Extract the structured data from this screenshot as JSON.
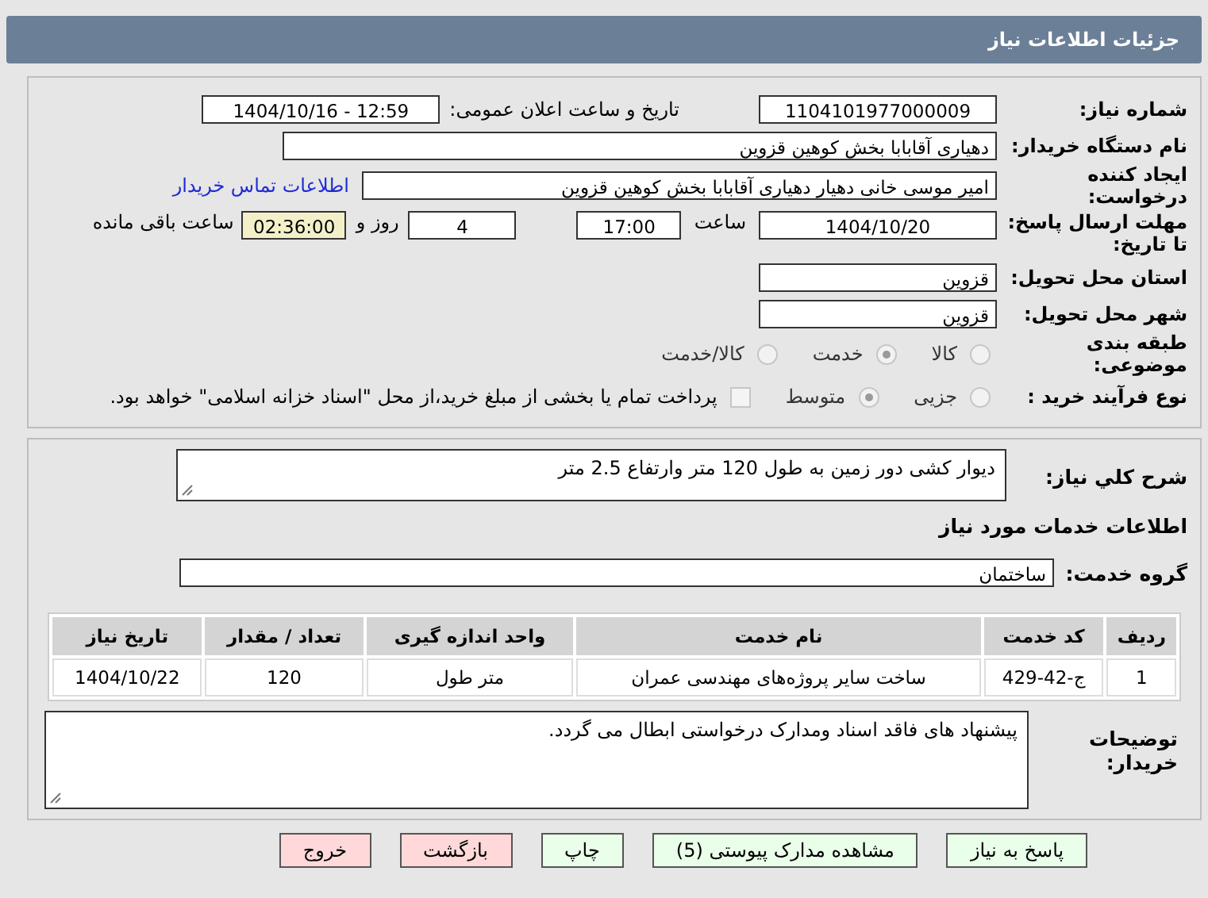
{
  "header": {
    "title": "جزئیات اطلاعات نیاز"
  },
  "need_number": {
    "label": "شماره نیاز:",
    "value": "1104101977000009"
  },
  "announce": {
    "label": "تاریخ و ساعت اعلان عمومی:",
    "value": "1404/10/16 - 12:59"
  },
  "buyer": {
    "label": "نام دستگاه خریدار:",
    "value": "دهیاری آقابابا بخش کوهین قزوین"
  },
  "creator": {
    "label": "ایجاد کننده درخواست:",
    "value": "امیر موسی خانی دهیار دهیاری آقابابا بخش کوهین قزوین",
    "link": "اطلاعات تماس خریدار"
  },
  "deadline": {
    "label": "مهلت ارسال پاسخ: تا تاریخ:",
    "date": "1404/10/20",
    "time_label": "ساعت",
    "time": "17:00",
    "days": "4",
    "days_label": "روز و",
    "remaining": "02:36:00",
    "remaining_label": "ساعت باقی مانده"
  },
  "province": {
    "label": "استان محل تحویل:",
    "value": "قزوین"
  },
  "city": {
    "label": "شهر محل تحویل:",
    "value": "قزوین"
  },
  "category": {
    "label": "طبقه بندی موضوعی:",
    "options": [
      {
        "label": "کالا",
        "selected": false
      },
      {
        "label": "خدمت",
        "selected": true
      },
      {
        "label": "کالا/خدمت",
        "selected": false
      }
    ]
  },
  "process": {
    "label": "نوع فرآیند خرید :",
    "options": [
      {
        "label": "جزیی",
        "selected": false
      },
      {
        "label": "متوسط",
        "selected": true
      }
    ],
    "payment": {
      "checked": false,
      "text": "پرداخت تمام یا بخشی از مبلغ خرید،از محل \"اسناد خزانه اسلامی\" خواهد بود."
    }
  },
  "description": {
    "label": "شرح کلي نياز:",
    "value": "دیوار کشی دور زمین به طول 120 متر وارتفاع 2.5 متر"
  },
  "services": {
    "heading": "اطلاعات خدمات مورد نیاز",
    "group_label": "گروه خدمت:",
    "group": "ساختمان",
    "table": {
      "columns": [
        "ردیف",
        "کد خدمت",
        "نام خدمت",
        "واحد اندازه گیری",
        "تعداد / مقدار",
        "تاریخ نیاز"
      ],
      "rows": [
        [
          "1",
          "ج-42-429",
          "ساخت سایر پروژه‌های مهندسی عمران",
          "متر طول",
          "120",
          "1404/10/22"
        ]
      ]
    }
  },
  "notes": {
    "label": "توضیحات خریدار:",
    "value": "پیشنهاد های فاقد اسناد ومدارک درخواستی ابطال می گردد."
  },
  "buttons": [
    {
      "label": "پاسخ به نیاز",
      "kind": "primary"
    },
    {
      "label": "مشاهده مدارک پیوستی (5)",
      "kind": "primary"
    },
    {
      "label": "چاپ",
      "kind": "primary"
    },
    {
      "label": "بازگشت",
      "kind": "danger"
    },
    {
      "label": "خروج",
      "kind": "danger"
    }
  ]
}
